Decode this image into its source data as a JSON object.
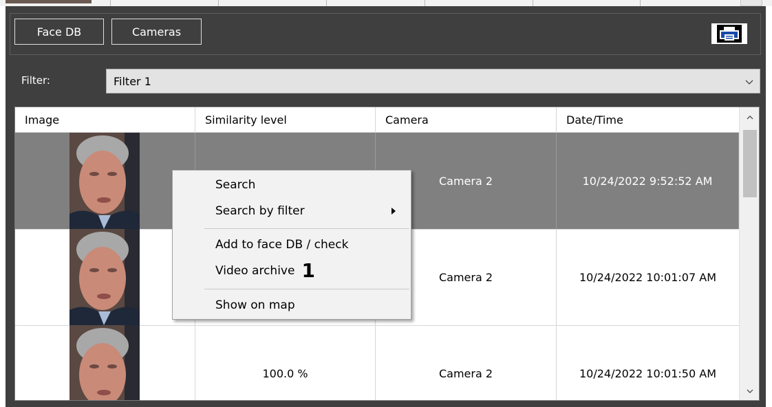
{
  "toolbar": {
    "face_db_label": "Face DB",
    "cameras_label": "Cameras",
    "print_icon": "printer-icon"
  },
  "filter": {
    "label": "Filter:",
    "value": "Filter 1"
  },
  "table": {
    "columns": [
      "Image",
      "Similarity level",
      "Camera",
      "Date/Time"
    ],
    "rows": [
      {
        "similarity": "",
        "camera": "Camera 2",
        "datetime": "10/24/2022 9:52:52 AM",
        "selected": true
      },
      {
        "similarity": "",
        "camera": "Camera 2",
        "datetime": "10/24/2022 10:01:07 AM",
        "selected": false
      },
      {
        "similarity": "100.0 %",
        "camera": "Camera 2",
        "datetime": "10/24/2022 10:01:50 AM",
        "selected": false
      }
    ]
  },
  "context_menu": {
    "items": [
      "Search",
      "Search by filter",
      "Add to face DB / check",
      "Video archive",
      "Show on map"
    ],
    "callout": "1"
  },
  "colors": {
    "panel_bg": "#3f3f3f",
    "selected_row": "#808080",
    "menu_bg": "#f2f2f2"
  }
}
